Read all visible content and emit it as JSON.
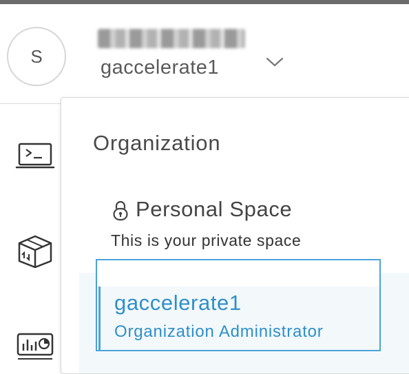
{
  "header": {
    "avatar_initial": "S",
    "username": "",
    "org_name": "gaccelerate1"
  },
  "leftnav": {
    "items": [
      {
        "icon": "terminal-laptop-icon"
      },
      {
        "icon": "package-transfer-icon"
      },
      {
        "icon": "monitor-chart-icon"
      }
    ]
  },
  "dropdown": {
    "section_title": "Organization",
    "personal": {
      "title": "Personal Space",
      "subtitle": "This is your private space",
      "icon": "lock-icon"
    },
    "orgs": [
      {
        "name": "gaccelerate1",
        "role": "Organization Administrator",
        "selected": true
      }
    ]
  },
  "colors": {
    "accent": "#2f8fc8",
    "selected_border": "#4aa3d8",
    "selected_bg": "#f3f8fb",
    "topbar": "#6b6b6b"
  }
}
